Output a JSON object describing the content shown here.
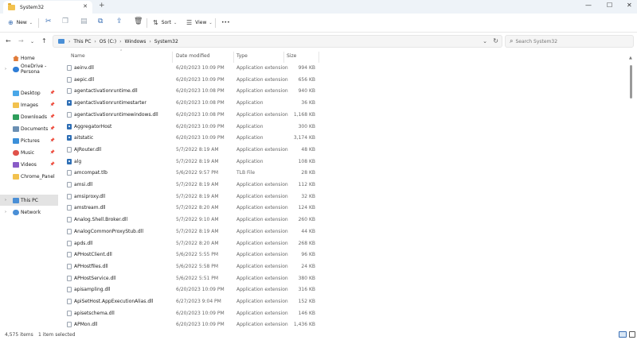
{
  "window": {
    "tab_title": "System32",
    "tab_close": "✕",
    "tab_add": "+",
    "minimize": "—",
    "maximize": "☐",
    "close": "✕"
  },
  "toolbar": {
    "new_label": "New",
    "sort_label": "Sort",
    "view_label": "View",
    "more_label": "•••"
  },
  "address": {
    "crumbs": [
      "This PC",
      "OS (C:)",
      "Windows",
      "System32"
    ],
    "separator": "›",
    "search_placeholder": "Search System32"
  },
  "sidebar": {
    "items": [
      {
        "label": "Home"
      },
      {
        "label": "OneDrive - Persona"
      },
      {
        "label": "Desktop"
      },
      {
        "label": "Images"
      },
      {
        "label": "Downloads"
      },
      {
        "label": "Documents"
      },
      {
        "label": "Pictures"
      },
      {
        "label": "Music"
      },
      {
        "label": "Videos"
      },
      {
        "label": "Chrome_Panel"
      },
      {
        "label": "This PC"
      },
      {
        "label": "Network"
      }
    ]
  },
  "columns": {
    "name": "Name",
    "date": "Date modified",
    "type": "Type",
    "size": "Size"
  },
  "files": [
    {
      "name": "aeinv.dll",
      "date": "6/20/2023 10:09 PM",
      "type": "Application extension",
      "size": "994 KB",
      "icon": "dll"
    },
    {
      "name": "aepic.dll",
      "date": "6/20/2023 10:09 PM",
      "type": "Application extension",
      "size": "656 KB",
      "icon": "dll"
    },
    {
      "name": "agentactivationruntime.dll",
      "date": "6/20/2023 10:08 PM",
      "type": "Application extension",
      "size": "940 KB",
      "icon": "dll"
    },
    {
      "name": "agentactivationruntimestarter",
      "date": "6/20/2023 10:08 PM",
      "type": "Application",
      "size": "36 KB",
      "icon": "app"
    },
    {
      "name": "agentactivationruntimewindows.dll",
      "date": "6/20/2023 10:08 PM",
      "type": "Application extension",
      "size": "1,168 KB",
      "icon": "dll"
    },
    {
      "name": "AggregatorHost",
      "date": "6/20/2023 10:09 PM",
      "type": "Application",
      "size": "300 KB",
      "icon": "app"
    },
    {
      "name": "aitstatic",
      "date": "6/20/2023 10:09 PM",
      "type": "Application",
      "size": "3,174 KB",
      "icon": "app"
    },
    {
      "name": "AJRouter.dll",
      "date": "5/7/2022 8:19 AM",
      "type": "Application extension",
      "size": "48 KB",
      "icon": "dll"
    },
    {
      "name": "alg",
      "date": "5/7/2022 8:19 AM",
      "type": "Application",
      "size": "108 KB",
      "icon": "app"
    },
    {
      "name": "amcompat.tlb",
      "date": "5/6/2022 9:57 PM",
      "type": "TLB File",
      "size": "28 KB",
      "icon": "dll"
    },
    {
      "name": "amsi.dll",
      "date": "5/7/2022 8:19 AM",
      "type": "Application extension",
      "size": "112 KB",
      "icon": "dll"
    },
    {
      "name": "amsiproxy.dll",
      "date": "5/7/2022 8:19 AM",
      "type": "Application extension",
      "size": "32 KB",
      "icon": "dll"
    },
    {
      "name": "amstream.dll",
      "date": "5/7/2022 8:20 AM",
      "type": "Application extension",
      "size": "124 KB",
      "icon": "dll"
    },
    {
      "name": "Analog.Shell.Broker.dll",
      "date": "5/7/2022 9:10 AM",
      "type": "Application extension",
      "size": "260 KB",
      "icon": "dll"
    },
    {
      "name": "AnalogCommonProxyStub.dll",
      "date": "5/7/2022 8:19 AM",
      "type": "Application extension",
      "size": "44 KB",
      "icon": "dll"
    },
    {
      "name": "apds.dll",
      "date": "5/7/2022 8:20 AM",
      "type": "Application extension",
      "size": "268 KB",
      "icon": "dll"
    },
    {
      "name": "APHostClient.dll",
      "date": "5/6/2022 5:55 PM",
      "type": "Application extension",
      "size": "96 KB",
      "icon": "dll"
    },
    {
      "name": "APHostfiles.dll",
      "date": "5/6/2022 5:58 PM",
      "type": "Application extension",
      "size": "24 KB",
      "icon": "dll"
    },
    {
      "name": "APHostService.dll",
      "date": "5/6/2022 5:51 PM",
      "type": "Application extension",
      "size": "380 KB",
      "icon": "dll"
    },
    {
      "name": "apisampling.dll",
      "date": "6/20/2023 10:09 PM",
      "type": "Application extension",
      "size": "316 KB",
      "icon": "dll"
    },
    {
      "name": "ApiSetHost.AppExecutionAlias.dll",
      "date": "6/27/2023 9:04 PM",
      "type": "Application extension",
      "size": "152 KB",
      "icon": "dll"
    },
    {
      "name": "apisetschema.dll",
      "date": "6/20/2023 10:09 PM",
      "type": "Application extension",
      "size": "146 KB",
      "icon": "dll"
    },
    {
      "name": "APMon.dll",
      "date": "6/20/2023 10:09 PM",
      "type": "Application extension",
      "size": "1,436 KB",
      "icon": "dll"
    }
  ],
  "status": {
    "item_count": "4,575 items",
    "selected": "1 item selected"
  }
}
